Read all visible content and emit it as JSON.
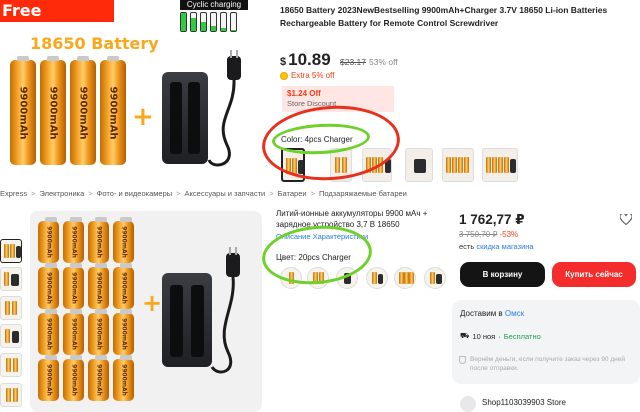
{
  "top": {
    "free_shipping": "Free shipping",
    "cyclic_charging": "Cyclic charging",
    "battery_heading": "18650 Battery",
    "battery_text": "9900mAh",
    "product_title": "18650 Battery 2023NewBestselling 9900mAh+Charger 3.7V 18650 Li-ion Batteries Rechargeable Battery for Remote Control Screwdriver",
    "currency": "$",
    "price": "10.89",
    "old_price": "$23.17",
    "discount_pct": "53% off",
    "extra": "Extra 5% off",
    "coupon": "$1.24 Off",
    "store_discount": "Store Discount",
    "color_label": "Color:",
    "color_value": "4pcs Charger"
  },
  "breadcrumb": [
    "Express",
    "Электроника",
    "Фото- и видеокамеры",
    "Аксессуары и запчасти",
    "Батареи",
    "Подзаряжаемые батареи"
  ],
  "bottom": {
    "title": "Литий-ионные аккумуляторы 9900 мАч + зарядное устройство 3,7 В 18650",
    "links": "Описание   Характеристики",
    "color_label": "Цвет:",
    "color_value": "20pcs Charger",
    "price": "1 762,77 ₽",
    "old_price": "3 750,70 ₽",
    "discount": "-53%",
    "with_text": "есть",
    "with_link": "скидка магазина",
    "cart_button": "В корзину",
    "buy_button": "Купить сейчас",
    "delivery_prefix": "Доставим в",
    "delivery_city": "Омск",
    "delivery_date": "10 ноя",
    "delivery_dash": "·",
    "delivery_free": "Бесплатно",
    "refund_text": "Вернём деньги, если получите заказ через 90 дней после отправки.",
    "store_name": "Shop1103039903 Store"
  },
  "colors": {
    "annotation_red": "#e8301c",
    "annotation_green": "#6ed12a",
    "battery_orange": "#f7a81b",
    "price_red": "#ff3c14",
    "link_blue": "#2a7de1",
    "buy_red": "#f42c2c"
  }
}
